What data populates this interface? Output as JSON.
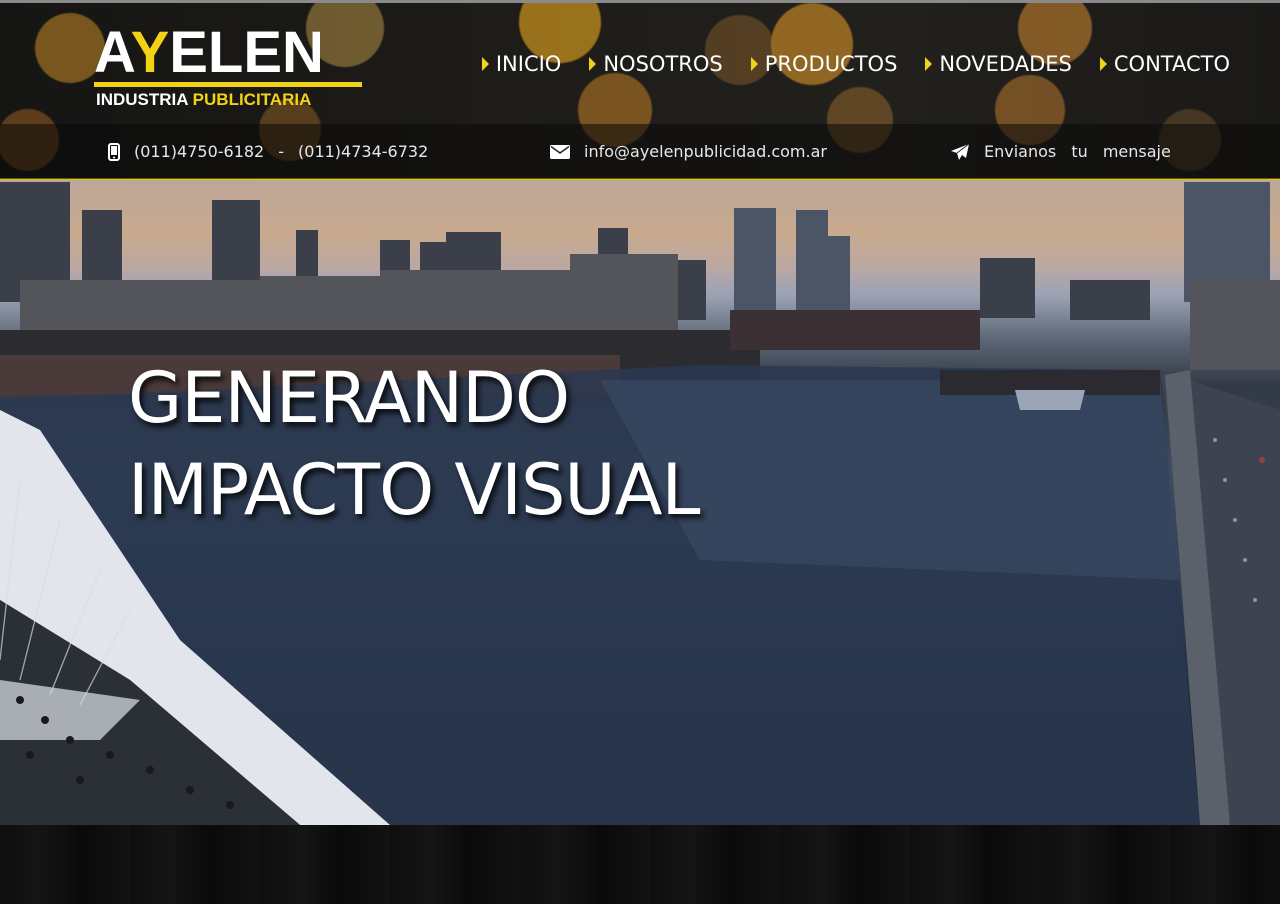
{
  "brand": {
    "name_first": "A",
    "name_accent": "Y",
    "name_rest": "ELEN",
    "tagline_first": "INDUSTRIA",
    "tagline_accent": "PUBLICITARIA",
    "accent_color": "#f1d217"
  },
  "nav": {
    "items": [
      {
        "label": "INICIO"
      },
      {
        "label": "NOSOTROS"
      },
      {
        "label": "PRODUCTOS"
      },
      {
        "label": "NOVEDADES"
      },
      {
        "label": "CONTACTO"
      }
    ]
  },
  "contact_bar": {
    "phone_icon": "mobile-phone-icon",
    "phone_1": "(011)4750-6182",
    "separator": "-",
    "phone_2": "(011)4734-6732",
    "email_icon": "envelope-icon",
    "email": "info@ayelenpublicidad.com.ar",
    "message_icon": "paper-plane-icon",
    "message_label": "Envianos tu mensaje"
  },
  "hero": {
    "line_1": "GENERANDO",
    "line_2": "IMPACTO VISUAL"
  }
}
